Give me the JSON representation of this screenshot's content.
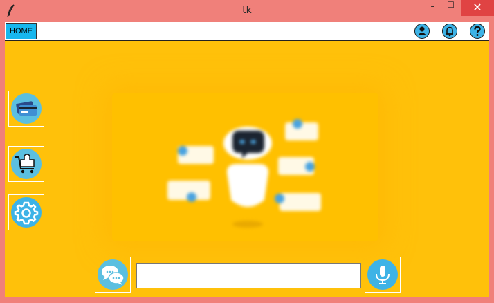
{
  "window": {
    "title": "tk",
    "minimize_glyph": "–",
    "maximize_glyph": "☐",
    "close_glyph": "✕"
  },
  "toolbar": {
    "home_label": "HOME",
    "icons": [
      "user-icon",
      "bell-icon",
      "help-icon"
    ]
  },
  "sidebar": {
    "items": [
      {
        "icon": "credit-card-icon"
      },
      {
        "icon": "shopping-cart-icon"
      },
      {
        "icon": "settings-gear-icon"
      }
    ]
  },
  "chat_bar": {
    "chat_icon": "chat-bubbles-icon",
    "input_value": "",
    "mic_icon": "microphone-icon"
  },
  "colors": {
    "background": "#ffc10a",
    "accent": "#4ab8e0",
    "window_chrome": "#f0807a",
    "close_red": "#e04343"
  }
}
